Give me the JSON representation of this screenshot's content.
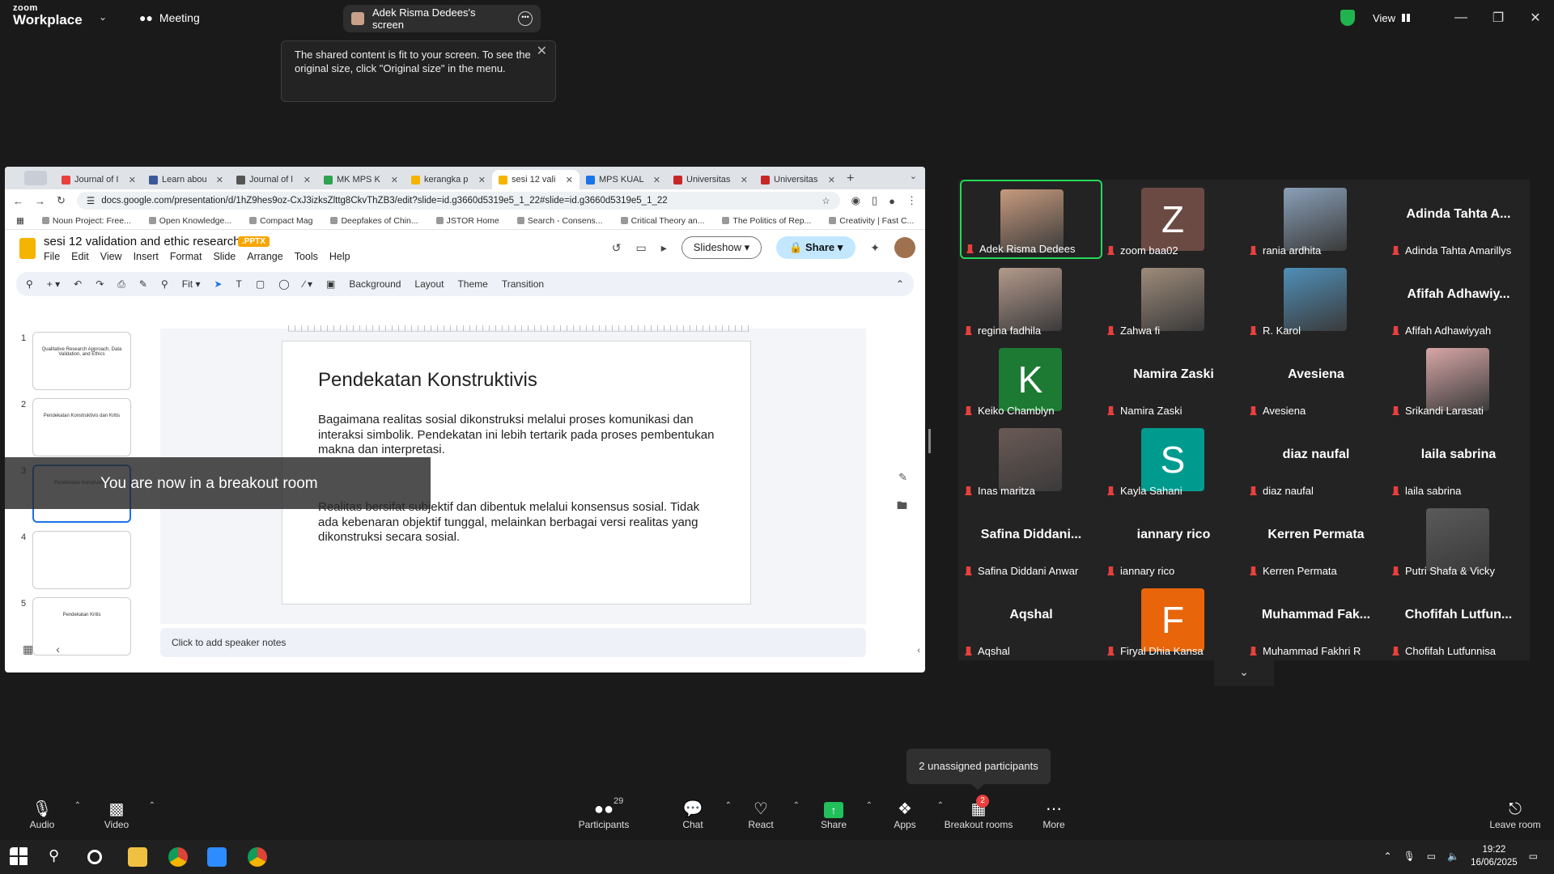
{
  "zoom": {
    "logo_top": "zoom",
    "logo_bottom": "Workplace",
    "meeting_label": "Meeting",
    "share_tab": "Adek Risma Dedees's screen",
    "view_label": "View",
    "tooltip": "The shared content is fit to your screen. To see the original size, click \"Original size\" in the menu."
  },
  "browser": {
    "tabs": [
      {
        "label": "Journal of I",
        "color": "#e8403d"
      },
      {
        "label": "Learn abou",
        "color": "#3b5998"
      },
      {
        "label": "Journal of l",
        "color": "#555555"
      },
      {
        "label": "MK MPS K",
        "color": "#2ea44f"
      },
      {
        "label": "kerangka p",
        "color": "#f4b400"
      },
      {
        "label": "sesi 12 vali",
        "color": "#f4b400"
      },
      {
        "label": "MPS KUAL",
        "color": "#1a73e8"
      },
      {
        "label": "Universitas",
        "color": "#c62828"
      },
      {
        "label": "Universitas",
        "color": "#c62828"
      }
    ],
    "url": "docs.google.com/presentation/d/1hZ9hes9oz-CxJ3izksZlttg8CkvThZB3/edit?slide=id.g3660d5319e5_1_22#slide=id.g3660d5319e5_1_22",
    "bookmarks": [
      "Noun Project: Free...",
      "Open Knowledge...",
      "Compact Mag",
      "Deepfakes of Chin...",
      "JSTOR Home",
      "Search - Consens...",
      "Critical Theory an...",
      "The Politics of Rep...",
      "Creativity | Fast C..."
    ]
  },
  "docs": {
    "title": "sesi 12 validation and ethic research",
    "badge": ".PPTX",
    "menus": [
      "File",
      "Edit",
      "View",
      "Insert",
      "Format",
      "Slide",
      "Arrange",
      "Tools",
      "Help"
    ],
    "slideshow": "Slideshow",
    "share": "Share",
    "toolbar": {
      "zoom": "Fit",
      "background": "Background",
      "layout": "Layout",
      "theme": "Theme",
      "transition": "Transition"
    },
    "thumbnails": [
      {
        "num": "1",
        "text": "Qualitative Research Approach, Data Validation, and Ethics"
      },
      {
        "num": "2",
        "text": "Pendekatan Konstruktivis dan Kritis"
      },
      {
        "num": "3",
        "text": "Pendekatan Konstruktivis"
      },
      {
        "num": "4",
        "text": ""
      },
      {
        "num": "5",
        "text": "Pendekatan Kritis"
      }
    ],
    "slide": {
      "title": "Pendekatan Konstruktivis",
      "para1": "Bagaimana realitas sosial dikonstruksi melalui proses komunikasi dan interaksi simbolik. Pendekatan ini lebih tertarik pada proses pembentukan makna dan interpretasi.",
      "para2": "Realitas bersifat subjektif dan dibentuk melalui konsensus sosial. Tidak ada kebenaran objektif tunggal, melainkan berbagai versi realitas yang dikonstruksi secara sosial."
    },
    "notes": "Click to add speaker notes"
  },
  "toast": "You are now in a breakout room",
  "participants": [
    {
      "name": "Adek Risma Dedees",
      "type": "video",
      "color": "#c79a7e",
      "active": true
    },
    {
      "name": "zoom baa02",
      "type": "letter",
      "letter": "Z",
      "color": "#6b4a44"
    },
    {
      "name": "rania ardhita",
      "type": "video",
      "color": "#8aa0b8"
    },
    {
      "name": "Adinda Tahta Amarillys",
      "type": "text",
      "display": "Adinda Tahta A..."
    },
    {
      "name": "regina fadhila",
      "type": "video",
      "color": "#b49a8c"
    },
    {
      "name": "Zahwa fi",
      "type": "video",
      "color": "#9e8b7a"
    },
    {
      "name": "R. Karol",
      "type": "video",
      "color": "#4f8fb8"
    },
    {
      "name": "Afifah Adhawiyyah",
      "type": "text",
      "display": "Afifah Adhawiy..."
    },
    {
      "name": "Keiko Chamblyn",
      "type": "letter",
      "letter": "K",
      "color": "#1d7a33"
    },
    {
      "name": "Namira Zaski",
      "type": "text",
      "display": "Namira Zaski"
    },
    {
      "name": "Avesiena",
      "type": "text",
      "display": "Avesiena"
    },
    {
      "name": "Srikandi Larasati",
      "type": "video",
      "color": "#d8a6a6"
    },
    {
      "name": "Inas maritza",
      "type": "video",
      "color": "#6b5a55"
    },
    {
      "name": "Kayla Sahani",
      "type": "letter",
      "letter": "S",
      "color": "#009b8f"
    },
    {
      "name": "diaz naufal",
      "type": "text",
      "display": "diaz naufal"
    },
    {
      "name": "laila sabrina",
      "type": "text",
      "display": "laila sabrina"
    },
    {
      "name": "Safina Diddani Anwar",
      "type": "text",
      "display": "Safina  Diddani..."
    },
    {
      "name": "iannary rico",
      "type": "text",
      "display": "iannary rico"
    },
    {
      "name": "Kerren Permata",
      "type": "text",
      "display": "Kerren Permata"
    },
    {
      "name": "Putri Shafa & Vicky",
      "type": "video",
      "color": "#5a5a5a"
    },
    {
      "name": "Aqshal",
      "type": "text",
      "display": "Aqshal"
    },
    {
      "name": "Firyal Dhia Kansa",
      "type": "letter",
      "letter": "F",
      "color": "#e8650a"
    },
    {
      "name": "Muhammad Fakhri R",
      "type": "text",
      "display": "Muhammad  Fak..."
    },
    {
      "name": "Chofifah Lutfunnisa",
      "type": "text",
      "display": "Chofifah  Lutfun..."
    }
  ],
  "unassigned": "2 unassigned participants",
  "toolbar": {
    "audio": "Audio",
    "video": "Video",
    "participants": "Participants",
    "participants_count": "29",
    "chat": "Chat",
    "react": "React",
    "share": "Share",
    "apps": "Apps",
    "breakout": "Breakout rooms",
    "breakout_badge": "2",
    "more": "More",
    "leave": "Leave room"
  },
  "taskbar": {
    "time": "19:22",
    "date": "16/06/2025"
  }
}
